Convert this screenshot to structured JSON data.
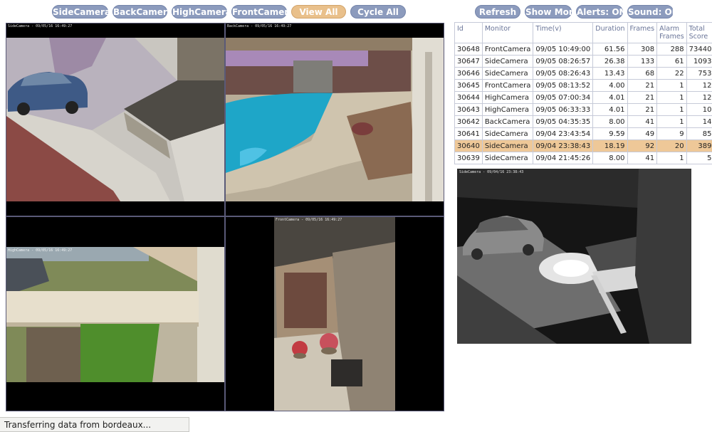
{
  "nav": {
    "buttons": [
      {
        "label": "SideCamera"
      },
      {
        "label": "BackCamera"
      },
      {
        "label": "HighCamera"
      },
      {
        "label": "FrontCamera"
      },
      {
        "label": "View All",
        "active": true
      },
      {
        "label": "Cycle All"
      },
      {
        "label": "Refresh"
      },
      {
        "label": "Show More"
      },
      {
        "label": "Alerts: ON"
      },
      {
        "label": "Sound: ON"
      }
    ]
  },
  "cameras": [
    {
      "name": "SideCamera",
      "overlay": "SideCamera - 09/05/16 16:49:27"
    },
    {
      "name": "BackCamera",
      "overlay": "BackCamera - 09/05/16 16:49:27"
    },
    {
      "name": "HighCamera",
      "overlay": "HighCamera - 09/05/16 16:49:27"
    },
    {
      "name": "FrontCamera",
      "overlay": "FrontCamera - 09/05/16 16:49:27"
    }
  ],
  "events": {
    "headers": [
      "Id",
      "Monitor",
      "Time(v)",
      "Duration",
      "Frames",
      "Alarm Frames",
      "Total Score"
    ],
    "rows": [
      [
        "30648",
        "FrontCamera",
        "09/05 10:49:00",
        "61.56",
        "308",
        "288",
        "73440"
      ],
      [
        "30647",
        "SideCamera",
        "09/05 08:26:57",
        "26.38",
        "133",
        "61",
        "1093"
      ],
      [
        "30646",
        "SideCamera",
        "09/05 08:26:43",
        "13.43",
        "68",
        "22",
        "753"
      ],
      [
        "30645",
        "FrontCamera",
        "09/05 08:13:52",
        "4.00",
        "21",
        "1",
        "12"
      ],
      [
        "30644",
        "HighCamera",
        "09/05 07:00:34",
        "4.01",
        "21",
        "1",
        "12"
      ],
      [
        "30643",
        "HighCamera",
        "09/05 06:33:33",
        "4.01",
        "21",
        "1",
        "10"
      ],
      [
        "30642",
        "BackCamera",
        "09/05 04:35:35",
        "8.00",
        "41",
        "1",
        "14"
      ],
      [
        "30641",
        "SideCamera",
        "09/04 23:43:54",
        "9.59",
        "49",
        "9",
        "85"
      ],
      [
        "30640",
        "SideCamera",
        "09/04 23:38:43",
        "18.19",
        "92",
        "20",
        "389"
      ],
      [
        "30639",
        "SideCamera",
        "09/04 21:45:26",
        "8.00",
        "41",
        "1",
        "5"
      ]
    ],
    "highlighted_row": 8
  },
  "event_image": {
    "overlay": "SideCamera - 09/04/16 23:38:43"
  },
  "status": {
    "text": "Transferring data from bordeaux..."
  },
  "colors": {
    "button": "#8c9bbd",
    "button_active": "#e9c08b",
    "highlight_row": "#eec898",
    "header_text": "#6a7598"
  }
}
